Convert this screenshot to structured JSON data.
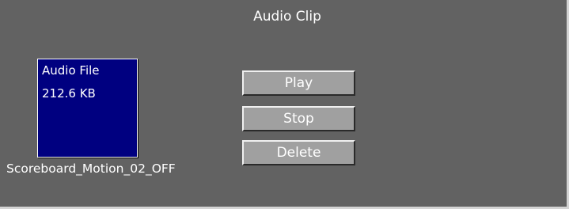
{
  "panel": {
    "title": "Audio Clip"
  },
  "file_tile": {
    "type_label": "Audio File",
    "size": "212.6 KB",
    "name": "Scoreboard_Motion_02_OFF"
  },
  "buttons": {
    "play": "Play",
    "stop": "Stop",
    "delete": "Delete"
  },
  "colors": {
    "panel_background": "#626262",
    "tile_background": "#000080",
    "button_face": "#a0a0a0",
    "text": "#ffffff"
  }
}
